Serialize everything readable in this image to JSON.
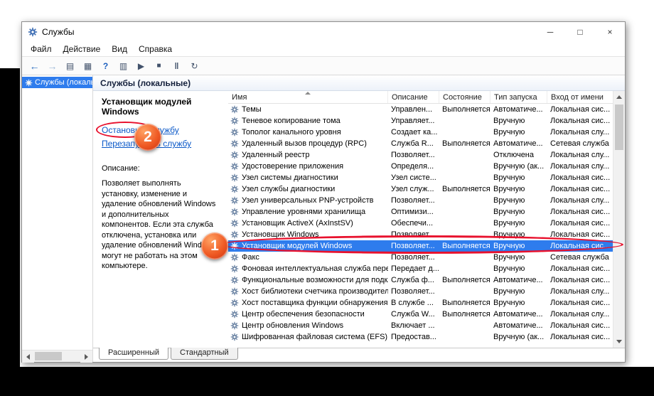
{
  "window": {
    "title": "Службы",
    "controls": [
      {
        "name": "minimize",
        "glyph": "─"
      },
      {
        "name": "maximize",
        "glyph": "□"
      },
      {
        "name": "close",
        "glyph": "×"
      }
    ]
  },
  "menu": {
    "items": [
      "Файл",
      "Действие",
      "Вид",
      "Справка"
    ]
  },
  "toolbar": {
    "buttons": [
      {
        "name": "back",
        "glyph": "←"
      },
      {
        "name": "forward",
        "glyph": "→"
      },
      {
        "name": "show-console-tree",
        "glyph": "▤"
      },
      {
        "name": "export-list",
        "glyph": "▦"
      },
      {
        "name": "help",
        "glyph": "?"
      },
      {
        "name": "show-properties",
        "glyph": "▥"
      },
      {
        "name": "start-service",
        "glyph": "▶"
      },
      {
        "name": "stop-service",
        "glyph": "■"
      },
      {
        "name": "pause-service",
        "glyph": "‖"
      },
      {
        "name": "restart-service",
        "glyph": "↻"
      }
    ]
  },
  "tree": {
    "root_label": "Службы (локальн"
  },
  "main_header": "Службы (локальные)",
  "details": {
    "service_title": "Установщик модулей Windows",
    "stop_link_word": "Остановить",
    "stop_link_rest": " службу",
    "restart_link": "Перезапустить службу",
    "description_label": "Описание:",
    "description_text": "Позволяет выполнять установку, изменение и удаление обновлений Windows и дополнительных компонентов. Если эта служба отключена, установка или удаление обновлений Windows могут не работать на этом компьютере."
  },
  "table": {
    "columns": [
      {
        "label": "Имя",
        "sorted": true
      },
      {
        "label": "Описание"
      },
      {
        "label": "Состояние"
      },
      {
        "label": "Тип запуска"
      },
      {
        "label": "Вход от имени"
      }
    ],
    "selected_index": 12,
    "rows": [
      {
        "name": "Темы",
        "desc": "Управлен...",
        "status": "Выполняется",
        "startup": "Автоматиче...",
        "login": "Локальная сис..."
      },
      {
        "name": "Теневое копирование тома",
        "desc": "Управляет...",
        "status": "",
        "startup": "Вручную",
        "login": "Локальная сис..."
      },
      {
        "name": "Тополог канального уровня",
        "desc": "Создает ка...",
        "status": "",
        "startup": "Вручную",
        "login": "Локальная слу..."
      },
      {
        "name": "Удаленный вызов процедур (RPC)",
        "desc": "Служба R...",
        "status": "Выполняется",
        "startup": "Автоматиче...",
        "login": "Сетевая служба"
      },
      {
        "name": "Удаленный реестр",
        "desc": "Позволяет...",
        "status": "",
        "startup": "Отключена",
        "login": "Локальная слу..."
      },
      {
        "name": "Удостоверение приложения",
        "desc": "Определя...",
        "status": "",
        "startup": "Вручную (ак...",
        "login": "Локальная слу..."
      },
      {
        "name": "Узел системы диагностики",
        "desc": "Узел систе...",
        "status": "",
        "startup": "Вручную",
        "login": "Локальная сис..."
      },
      {
        "name": "Узел службы диагностики",
        "desc": "Узел служ...",
        "status": "Выполняется",
        "startup": "Вручную",
        "login": "Локальная сис..."
      },
      {
        "name": "Узел универсальных PNP-устройств",
        "desc": "Позволяет...",
        "status": "",
        "startup": "Вручную",
        "login": "Локальная слу..."
      },
      {
        "name": "Управление уровнями хранилища",
        "desc": "Оптимизи...",
        "status": "",
        "startup": "Вручную",
        "login": "Локальная сис..."
      },
      {
        "name": "Установщик ActiveX (AxInstSV)",
        "desc": "Обеспечи...",
        "status": "",
        "startup": "Вручную",
        "login": "Локальная сис..."
      },
      {
        "name": "Установщик Windows",
        "desc": "Позволяет...",
        "status": "",
        "startup": "Вручную",
        "login": "Локальная сис..."
      },
      {
        "name": "Установщик модулей Windows",
        "desc": "Позволяет...",
        "status": "Выполняется",
        "startup": "Вручную",
        "login": "Локальная сис..."
      },
      {
        "name": "Факс",
        "desc": "Позволяет...",
        "status": "",
        "startup": "Вручную",
        "login": "Сетевая служба"
      },
      {
        "name": "Фоновая интеллектуальная служба передачи (...",
        "desc": "Передает д...",
        "status": "",
        "startup": "Вручную",
        "login": "Локальная сис..."
      },
      {
        "name": "Функциональные возможности для подключе...",
        "desc": "Служба ф...",
        "status": "Выполняется",
        "startup": "Автоматиче...",
        "login": "Локальная сис..."
      },
      {
        "name": "Хост библиотеки счетчика производительности",
        "desc": "Позволяет...",
        "status": "",
        "startup": "Вручную",
        "login": "Локальная слу..."
      },
      {
        "name": "Хост поставщика функции обнаружения",
        "desc": "В службе ...",
        "status": "Выполняется",
        "startup": "Вручную",
        "login": "Локальная сис..."
      },
      {
        "name": "Центр обеспечения безопасности",
        "desc": "Служба W...",
        "status": "Выполняется",
        "startup": "Автоматиче...",
        "login": "Локальная слу..."
      },
      {
        "name": "Центр обновления Windows",
        "desc": "Включает ...",
        "status": "",
        "startup": "Автоматиче...",
        "login": "Локальная сис..."
      },
      {
        "name": "Шифрованная файловая система (EFS)",
        "desc": "Предостав...",
        "status": "",
        "startup": "Вручную (ак...",
        "login": "Локальная сис..."
      }
    ]
  },
  "tabs": [
    {
      "label": "Расширенный",
      "active": true
    },
    {
      "label": "Стандартный",
      "active": false
    }
  ],
  "annotations": {
    "badge_selected_row": "1",
    "badge_stop_link": "2"
  },
  "colors": {
    "selection_blue": "#2e7ced",
    "link_blue": "#0a58c8",
    "annotation_red": "#e8112d"
  }
}
